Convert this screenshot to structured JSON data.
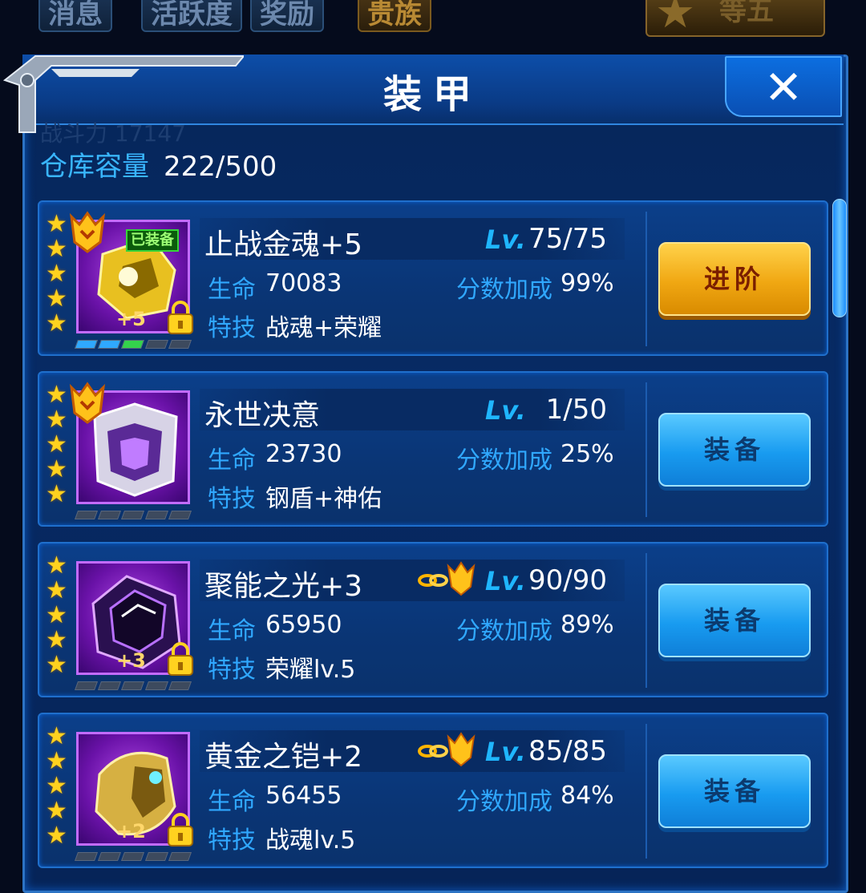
{
  "background_tabs": [
    "消息",
    "活跃度",
    "奖励",
    "贵族"
  ],
  "background_badge": "等五",
  "background_ghost_text": "战斗力 17147",
  "dialog": {
    "title": "装甲",
    "close_symbol": "✕"
  },
  "capacity": {
    "label": "仓库容量",
    "value": "222/500"
  },
  "labels": {
    "lv": "Lv.",
    "hp": "生命",
    "bonus": "分数加成",
    "skill": "特技"
  },
  "items": [
    {
      "name": "止战金魂+5",
      "level": "75/75",
      "hp": "70083",
      "bonus": "99%",
      "skill": "战魂+荣耀",
      "stars": 5,
      "plus": "+5",
      "equipped_tag": "已装备",
      "locked": true,
      "crowned": true,
      "linked": false,
      "button": "进阶",
      "button_style": "gold",
      "icon_color": "#d9a400"
    },
    {
      "name": "永世决意",
      "level": "1/50",
      "hp": "23730",
      "bonus": "25%",
      "skill": "钢盾+神佑",
      "stars": 5,
      "plus": "",
      "equipped_tag": "",
      "locked": false,
      "crowned": true,
      "linked": false,
      "button": "装备",
      "button_style": "blue",
      "icon_color": "#c7c3d8"
    },
    {
      "name": "聚能之光+3",
      "level": "90/90",
      "hp": "65950",
      "bonus": "89%",
      "skill": "荣耀lv.5",
      "stars": 5,
      "plus": "+3",
      "equipped_tag": "",
      "locked": true,
      "crowned": false,
      "linked": true,
      "button": "装备",
      "button_style": "blue",
      "icon_color": "#3a1a6a"
    },
    {
      "name": "黄金之铠+2",
      "level": "85/85",
      "hp": "56455",
      "bonus": "84%",
      "skill": "战魂lv.5",
      "stars": 5,
      "plus": "+2",
      "equipped_tag": "",
      "locked": true,
      "crowned": false,
      "linked": true,
      "button": "装备",
      "button_style": "blue",
      "icon_color": "#d6b042"
    }
  ]
}
